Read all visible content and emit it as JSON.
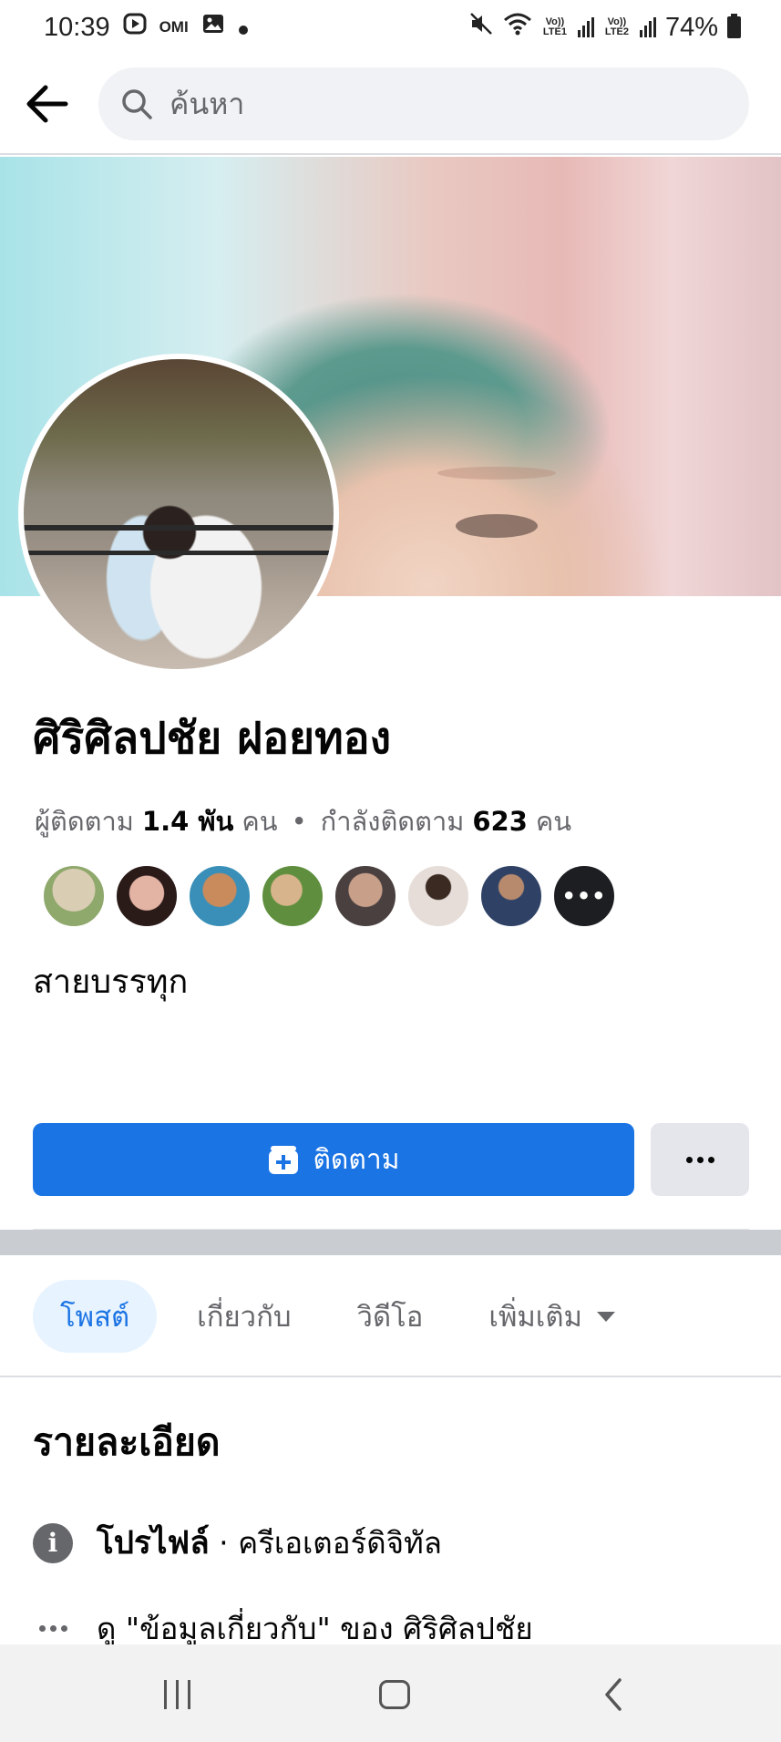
{
  "status_bar": {
    "time": "10:39",
    "left_icons": [
      "play-icon",
      "omi-icon",
      "gallery-icon",
      "dot-icon"
    ],
    "omi_label": "OMI",
    "sim1_label": "Vo)) LTE1",
    "sim2_label": "Vo)) LTE2",
    "battery_percent": "74%"
  },
  "header": {
    "back_icon": "arrow-left-icon",
    "search_placeholder": "ค้นหา"
  },
  "profile": {
    "name": "ศิริศิลปชัย ฝอยทอง",
    "followers_label": "ผู้ติดตาม",
    "followers_count": "1.4 พัน",
    "people_unit": "คน",
    "separator": "•",
    "following_label": "กำลังติดตาม",
    "following_count": "623",
    "bio": "สายบรรทุก"
  },
  "follower_avatars": {
    "colors": [
      "#cfc3a8",
      "#7a3f3a",
      "#c98a5c",
      "#5f8f3e",
      "#8b6d5d",
      "#c6b9b0",
      "#3d4f6e"
    ],
    "more_label": "•••"
  },
  "actions": {
    "follow_label": "ติดตาม",
    "follow_icon": "add-friend-icon",
    "more_icon": "more-dots-icon",
    "accent_color": "#1b74e4"
  },
  "tabs": [
    {
      "label": "โพสต์",
      "active": true
    },
    {
      "label": "เกี่ยวกับ",
      "active": false
    },
    {
      "label": "วิดีโอ",
      "active": false
    },
    {
      "label": "เพิ่มเติม",
      "active": false
    }
  ],
  "details": {
    "title": "รายละเอียด",
    "profile_type_bold": "โปรไฟล์",
    "profile_type_rest": " · ครีเอเตอร์ดิจิทัล",
    "see_about": "ดู \"ข้อมูลเกี่ยวกับ\" ของ ศิริศิลปชัย"
  },
  "nav_bar": {
    "icons": [
      "recent-apps-icon",
      "home-icon",
      "back-icon"
    ]
  }
}
